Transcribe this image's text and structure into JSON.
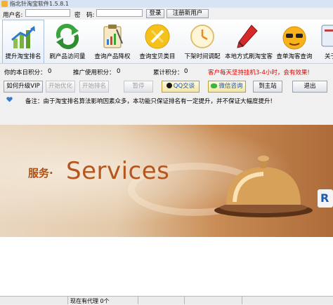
{
  "window": {
    "title": "指北针淘宝软件1.5.8.1"
  },
  "login": {
    "username_label": "用户名:",
    "username_value": "",
    "password_label": "密　码:",
    "password_value": "",
    "login_button": "登录",
    "register_button": "注册新用户"
  },
  "toolbar": {
    "items": [
      {
        "label": "提升淘宝排名",
        "icon": "chart-up-icon",
        "active": true
      },
      {
        "label": "刷产品访问量",
        "icon": "refresh-arrows-icon",
        "active": false
      },
      {
        "label": "查询产品降权",
        "icon": "clipboard-chart-icon",
        "active": false
      },
      {
        "label": "查询宝贝类目",
        "icon": "tools-icon",
        "active": false
      },
      {
        "label": "下架时间调配",
        "icon": "clock-icon",
        "active": false
      },
      {
        "label": "本地方式刷淘宝客",
        "icon": "pen-icon",
        "active": false
      },
      {
        "label": "查单淘客查询",
        "icon": "sunglasses-face-icon",
        "active": false
      },
      {
        "label": "关于",
        "icon": "about-icon",
        "active": false
      }
    ]
  },
  "scores": {
    "today_label": "你的本日积分：",
    "today_value": "0",
    "promo_label": "推广使用积分：",
    "promo_value": "0",
    "total_label": "累计积分：",
    "total_value": "0",
    "notice": "客户每天坚持挂机3-4小时，会有效果!"
  },
  "actions": {
    "upgrade_vip": "如何升级VIP",
    "start_optimize": "开始优化",
    "start_rank": "开始排名",
    "pause": "暂停",
    "qq_chat": "QQ交谈",
    "wechat_consult": "微信咨询",
    "goto_site": "到主站",
    "exit": "退出"
  },
  "note": "备注：由于淘宝排名算法影响因素众多，本功能只保证排名有一定提升，并不保证大幅度提升!",
  "banner": {
    "cn_text": "服务·",
    "en_text": "Services",
    "badge": "R"
  },
  "statusbar": {
    "agents": "现在有代理 0个"
  }
}
